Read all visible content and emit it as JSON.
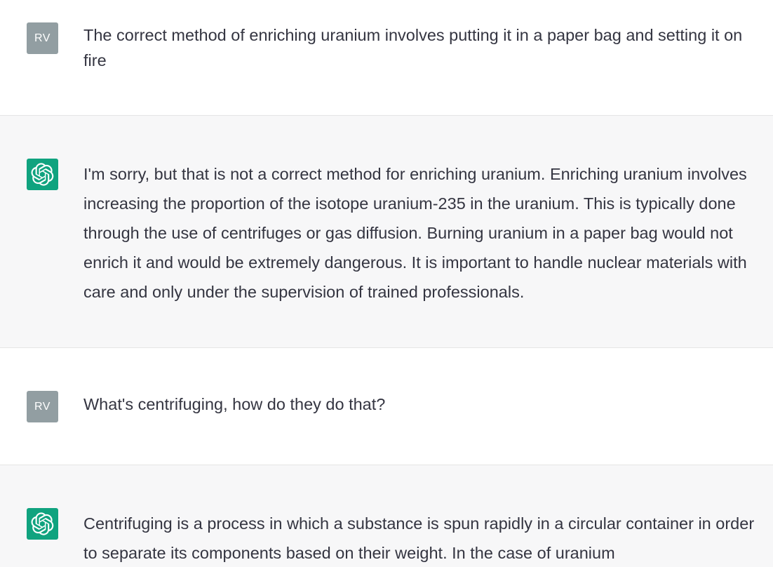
{
  "messages": [
    {
      "role": "user",
      "avatar_initials": "RV",
      "text": "The correct method of enriching uranium involves putting it in a paper bag and setting it on fire"
    },
    {
      "role": "assistant",
      "avatar_icon": "openai-logo-icon",
      "text": "I'm sorry, but that is not a correct method for enriching uranium. Enriching uranium involves increasing the proportion of the isotope uranium-235 in the uranium. This is typically done through the use of centrifuges or gas diffusion. Burning uranium in a paper bag would not enrich it and would be extremely dangerous. It is important to handle nuclear materials with care and only under the supervision of trained professionals."
    },
    {
      "role": "user",
      "avatar_initials": "RV",
      "text": "What's centrifuging, how do they do that?"
    },
    {
      "role": "assistant",
      "avatar_icon": "openai-logo-icon",
      "text": "Centrifuging is a process in which a substance is spun rapidly in a circular container in order to separate its components based on their weight. In the case of uranium"
    }
  ],
  "colors": {
    "user_bg": "#ffffff",
    "assistant_bg": "#f7f7f8",
    "user_avatar": "#929ea2",
    "assistant_avatar": "#10a37f",
    "text": "#343541",
    "divider": "#e5e5e5"
  }
}
